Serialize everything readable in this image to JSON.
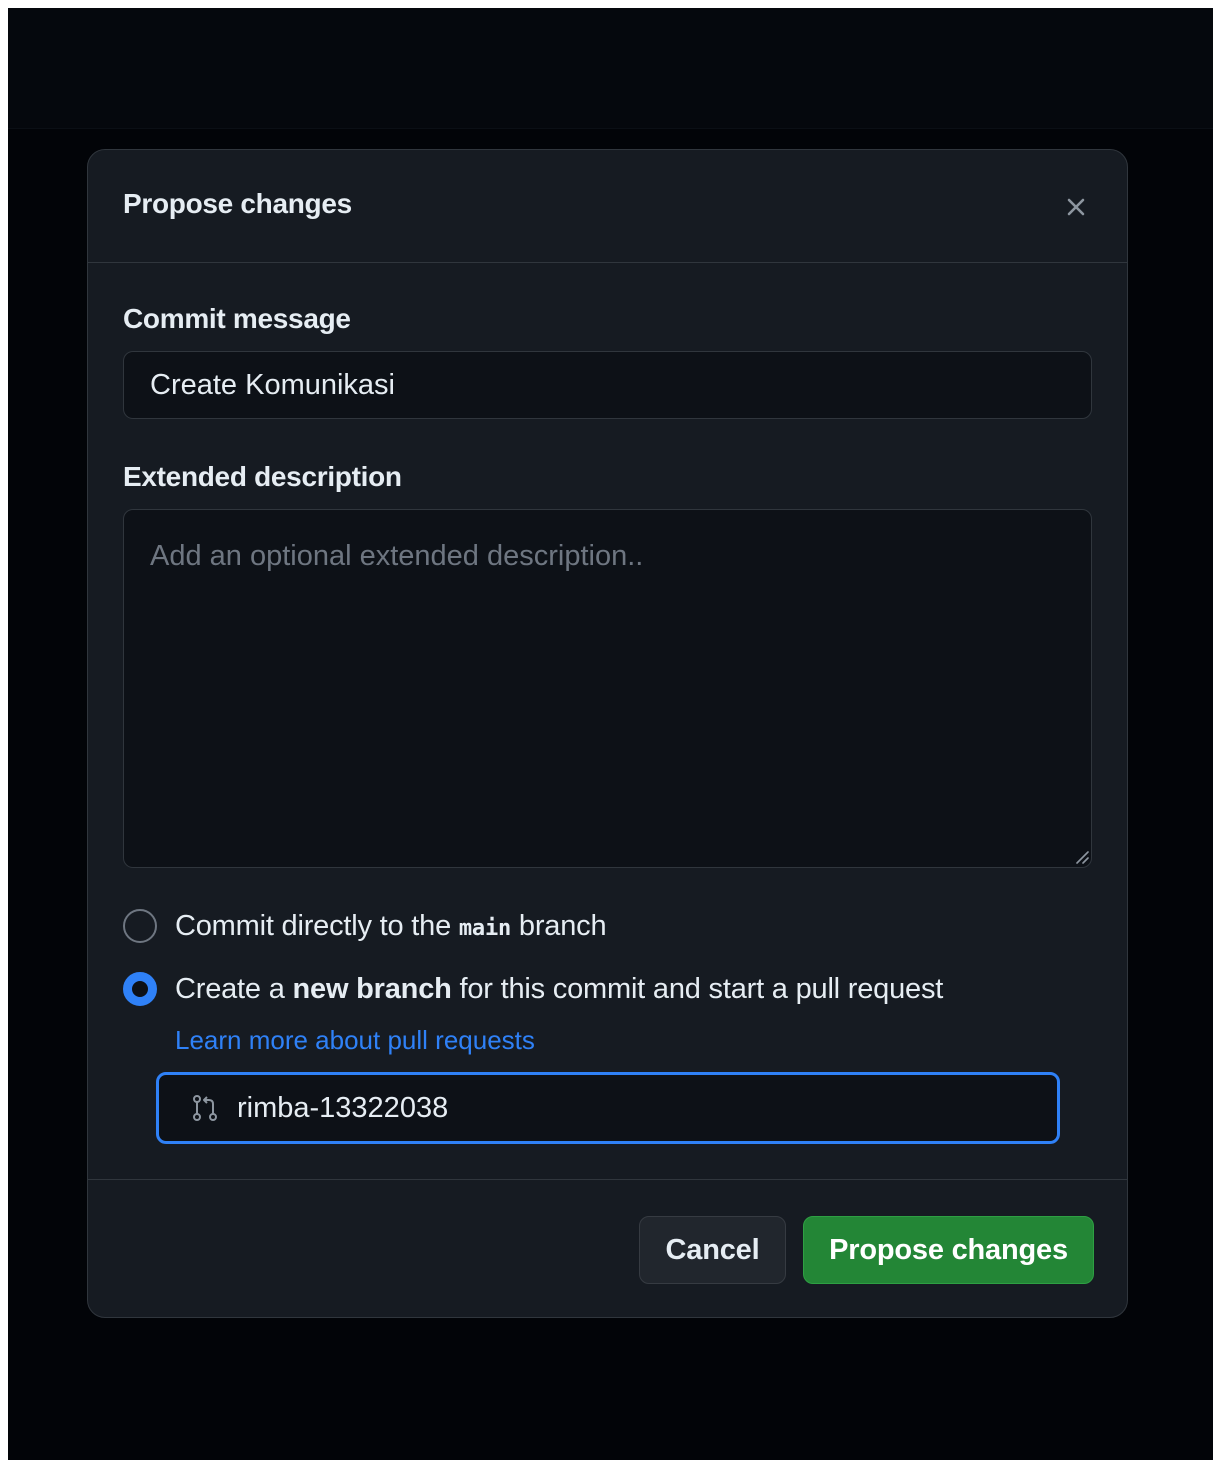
{
  "dialog": {
    "title": "Propose changes",
    "close_icon": "close-icon"
  },
  "commit_message": {
    "label": "Commit message",
    "value": "Create Komunikasi"
  },
  "extended_description": {
    "label": "Extended description",
    "placeholder": "Add an optional extended description..",
    "value": ""
  },
  "commit_options": {
    "direct": {
      "text_before": "Commit directly to the",
      "branch_code": "main",
      "text_after": "branch",
      "selected": false
    },
    "new_branch": {
      "text_before": "Create a",
      "bold": "new branch",
      "text_after": "for this commit and start a pull request",
      "selected": true
    },
    "learn_more_link": "Learn more about pull requests"
  },
  "branch_name": {
    "icon": "git-pull-request-icon",
    "value": "rimba-13322038"
  },
  "footer": {
    "cancel_label": "Cancel",
    "submit_label": "Propose changes"
  },
  "colors": {
    "accent_blue": "#2f81f7",
    "primary_green": "#238636",
    "dialog_bg": "#161b22",
    "input_bg": "#0d1117",
    "border": "#30363d"
  }
}
